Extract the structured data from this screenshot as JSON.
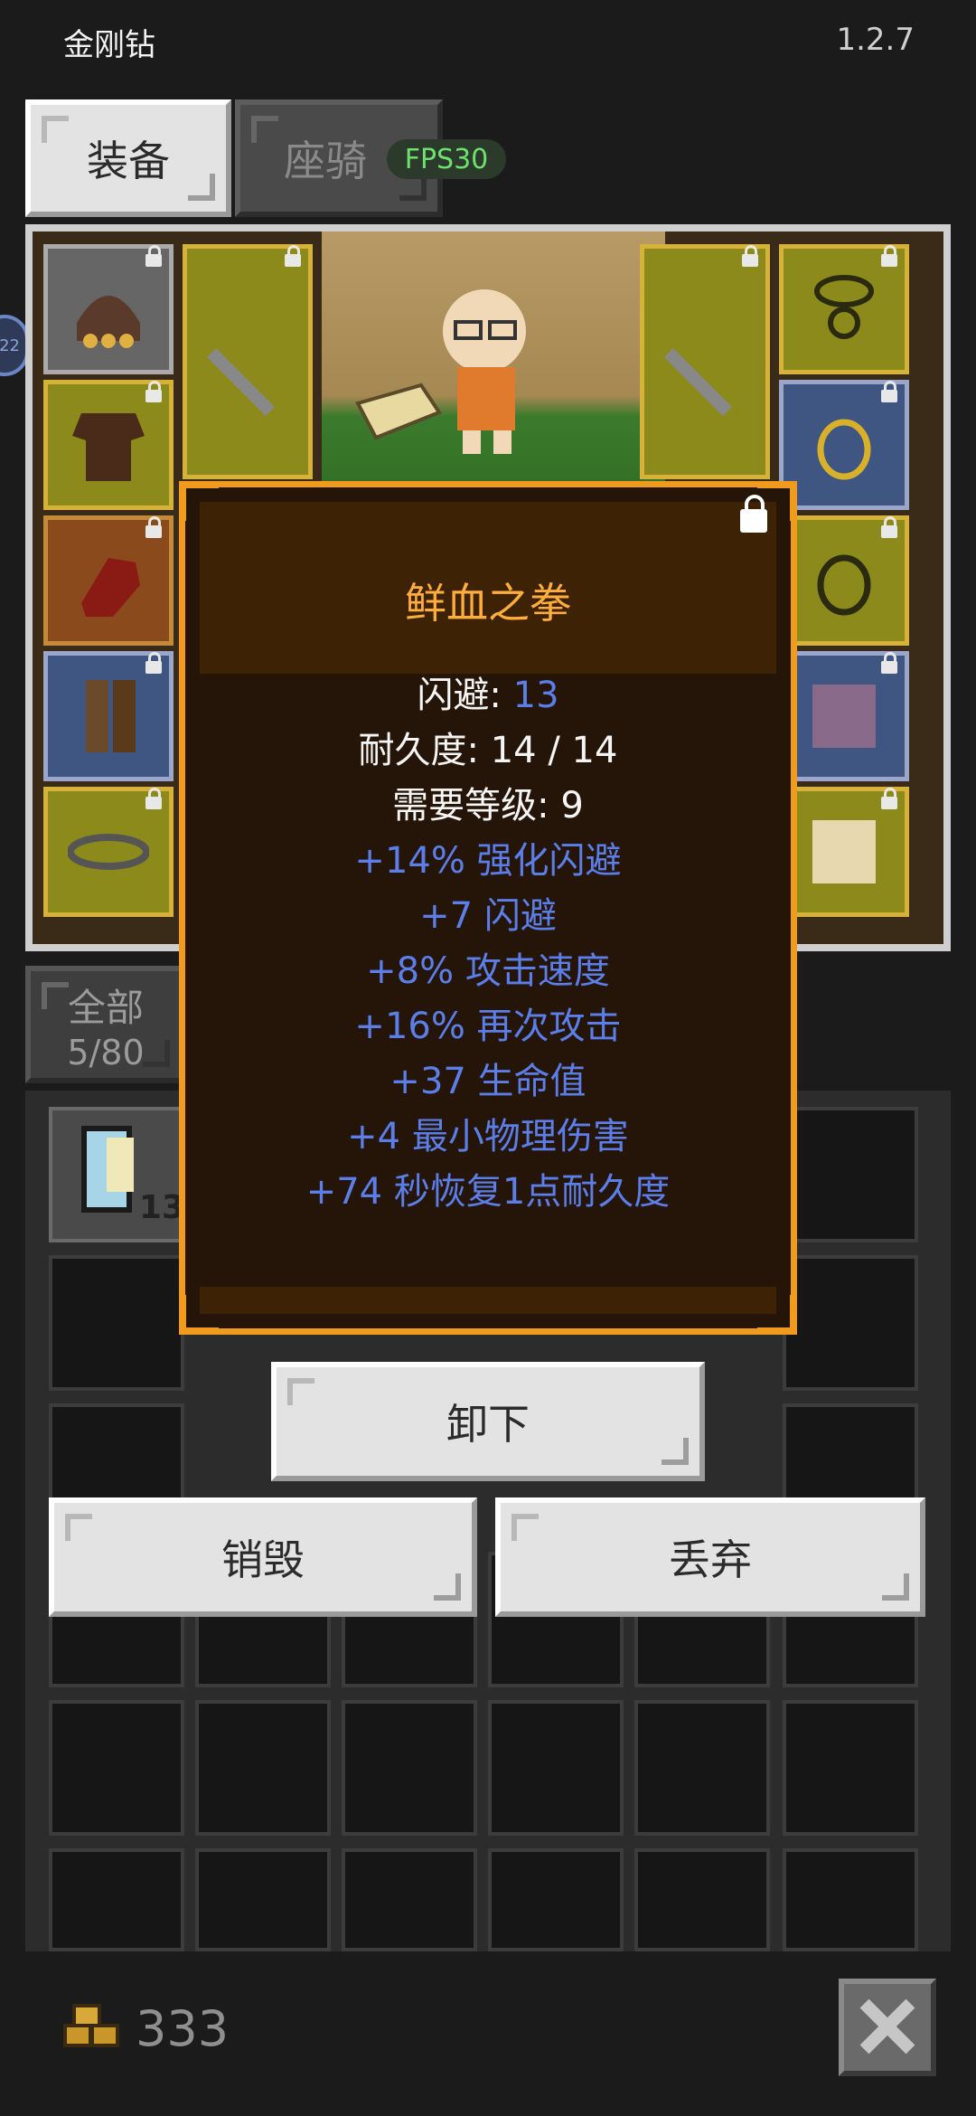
{
  "status": {
    "title": "金刚钻",
    "version": "1.2.7"
  },
  "tabs": {
    "equipment": "装备",
    "mount": "座骑",
    "fps": "FPS30"
  },
  "side_badge": "22",
  "inventory": {
    "all_label": "全部",
    "capacity": "5/80",
    "first_item_count": "13"
  },
  "tooltip": {
    "item_name": "鲜血之拳",
    "dodge_label": "闪避:",
    "dodge_value": "13",
    "durability": "耐久度: 14 / 14",
    "required_level": "需要等级: 9",
    "affixes": [
      "+14% 强化闪避",
      "+7 闪避",
      "+8% 攻击速度",
      "+16% 再次攻击",
      "+37 生命值",
      "+4 最小物理伤害",
      "+74 秒恢复1点耐久度"
    ]
  },
  "actions": {
    "unequip": "卸下",
    "destroy": "销毁",
    "discard": "丢弃"
  },
  "gold": "333",
  "colors": {
    "tooltip_border": "#f09a1e",
    "item_name": "#ffae3e",
    "affix_blue": "#5b7ee8",
    "fps_green": "#6ee06e"
  },
  "icons": [
    "helmet-icon",
    "sword-icon",
    "ring-icon",
    "armor-icon",
    "glove-icon",
    "boots-icon",
    "belt-icon",
    "scroll-icon",
    "gold-coins-icon",
    "close-icon",
    "lock-icon"
  ]
}
